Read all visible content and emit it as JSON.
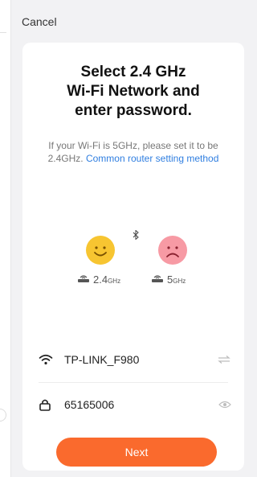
{
  "header": {
    "cancel_label": "Cancel"
  },
  "title": {
    "line1": "Select 2.4 GHz",
    "line2": "Wi-Fi Network and",
    "line3": "enter password."
  },
  "hint": {
    "text": "If your Wi-Fi is 5GHz, please set it to be 2.4GHz.",
    "link": "Common router setting method"
  },
  "bands": {
    "good": {
      "num": "2.4",
      "unit": "GHz"
    },
    "bad": {
      "num": "5",
      "unit": "GHz"
    }
  },
  "network": {
    "ssid": "TP-LINK_F980"
  },
  "password": {
    "value": "65165006"
  },
  "actions": {
    "next_label": "Next"
  },
  "colors": {
    "accent": "#fa6a2d",
    "link": "#2f7ee0",
    "happy_face": "#f7c531",
    "sad_face": "#f79aa4"
  },
  "icons": {
    "bluetooth": "bluetooth-icon",
    "wifi": "wifi-icon",
    "lock": "lock-icon",
    "switch": "switch-network-icon",
    "eye": "eye-icon",
    "router": "router-icon"
  }
}
